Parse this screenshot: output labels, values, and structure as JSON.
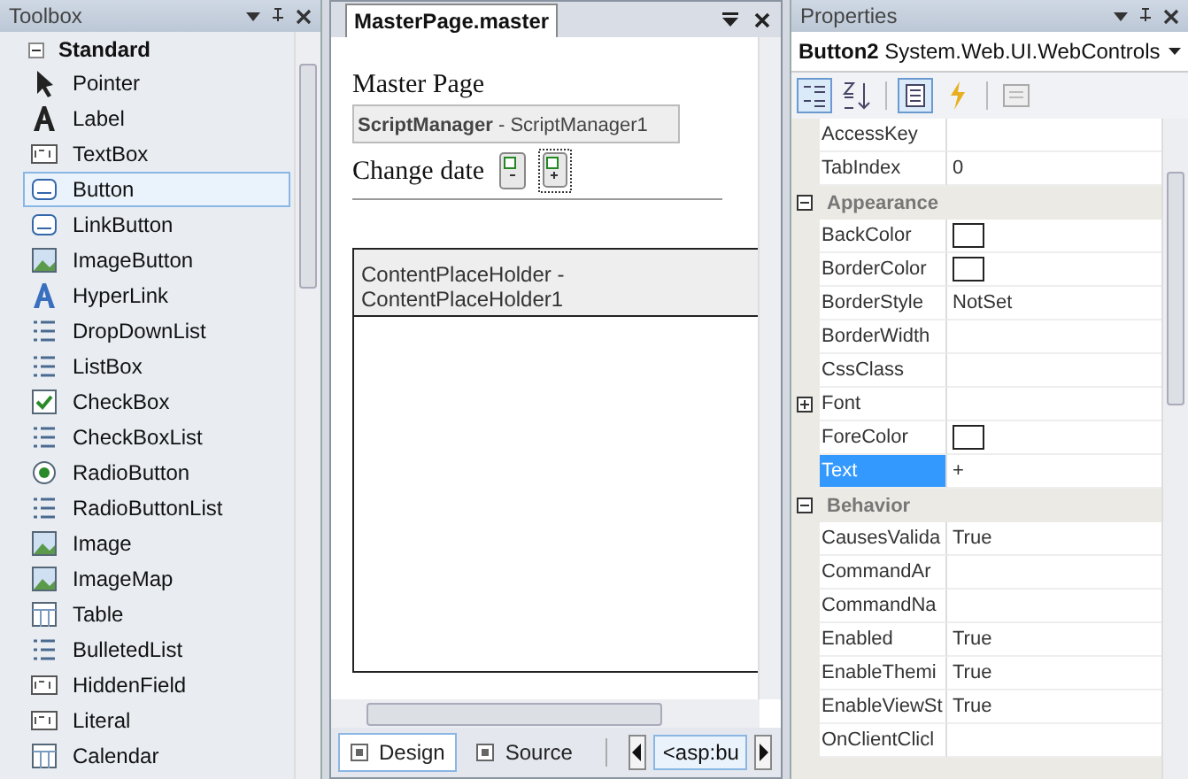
{
  "toolbox": {
    "title": "Toolbox",
    "group": {
      "label": "Standard",
      "expanded": true
    },
    "items": [
      {
        "label": "Pointer",
        "selected": false
      },
      {
        "label": "Label",
        "selected": false
      },
      {
        "label": "TextBox",
        "selected": false
      },
      {
        "label": "Button",
        "selected": true
      },
      {
        "label": "LinkButton",
        "selected": false
      },
      {
        "label": "ImageButton",
        "selected": false
      },
      {
        "label": "HyperLink",
        "selected": false
      },
      {
        "label": "DropDownList",
        "selected": false
      },
      {
        "label": "ListBox",
        "selected": false
      },
      {
        "label": "CheckBox",
        "selected": false
      },
      {
        "label": "CheckBoxList",
        "selected": false
      },
      {
        "label": "RadioButton",
        "selected": false
      },
      {
        "label": "RadioButtonList",
        "selected": false
      },
      {
        "label": "Image",
        "selected": false
      },
      {
        "label": "ImageMap",
        "selected": false
      },
      {
        "label": "Table",
        "selected": false
      },
      {
        "label": "BulletedList",
        "selected": false
      },
      {
        "label": "HiddenField",
        "selected": false
      },
      {
        "label": "Literal",
        "selected": false
      },
      {
        "label": "Calendar",
        "selected": false
      }
    ]
  },
  "designer": {
    "tab": "MasterPage.master",
    "heading": "Master Page",
    "script_manager": "**ScriptManager** - ScriptManager1",
    "label": "Change date",
    "placeholder_box": "ContentPlaceHolder - ContentPlaceHolder1",
    "view_tabs": [
      {
        "label": "Design",
        "selected": true
      },
      {
        "label": "Source",
        "selected": false
      }
    ],
    "breadcrumb": "<asp:bu"
  },
  "properties": {
    "title": "Properties",
    "object": "Button2",
    "type": "System.Web.UI.WebControls",
    "rows": [
      {
        "kind": "property",
        "name": "AccessKey",
        "value": "",
        "selected": false
      },
      {
        "kind": "property",
        "name": "TabIndex",
        "value": "0",
        "selected": false
      },
      {
        "kind": "category",
        "name": "Appearance",
        "expanded": true
      },
      {
        "kind": "color",
        "name": "BackColor",
        "selected": false
      },
      {
        "kind": "color",
        "name": "BorderColor",
        "selected": false
      },
      {
        "kind": "property",
        "name": "BorderStyle",
        "value": "NotSet",
        "selected": false
      },
      {
        "kind": "property",
        "name": "BorderWidth",
        "value": "",
        "selected": false
      },
      {
        "kind": "property",
        "name": "CssClass",
        "value": "",
        "selected": false
      },
      {
        "kind": "group",
        "name": "Font",
        "expanded": false,
        "selected": false
      },
      {
        "kind": "color",
        "name": "ForeColor",
        "selected": false
      },
      {
        "kind": "property",
        "name": "Text",
        "value": "+",
        "selected": true
      },
      {
        "kind": "category",
        "name": "Behavior",
        "expanded": true
      },
      {
        "kind": "property",
        "name": "CausesValida",
        "value": "True",
        "selected": false
      },
      {
        "kind": "property",
        "name": "CommandAr",
        "value": "",
        "selected": false
      },
      {
        "kind": "property",
        "name": "CommandNa",
        "value": "",
        "selected": false
      },
      {
        "kind": "property",
        "name": "Enabled",
        "value": "True",
        "selected": false
      },
      {
        "kind": "property",
        "name": "EnableThemi",
        "value": "True",
        "selected": false
      },
      {
        "kind": "property",
        "name": "EnableViewSt",
        "value": "True",
        "selected": false
      },
      {
        "kind": "property",
        "name": "OnClientClicl",
        "value": "",
        "selected": false
      }
    ]
  }
}
